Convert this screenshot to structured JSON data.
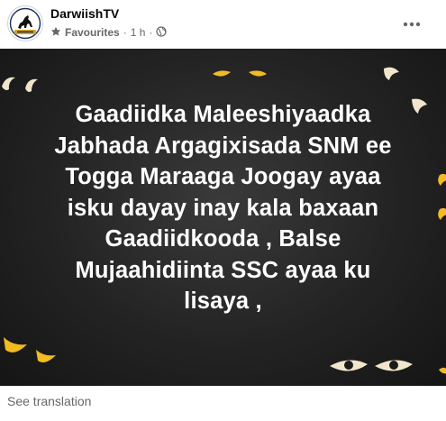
{
  "post": {
    "page_name": "DarwiishTV",
    "audience": "Favourites",
    "separator": "·",
    "time": "1 h",
    "separator2": "·",
    "logo_text": "DARWIISH TV",
    "text_lines": [
      "Gaadiidka Maleeshiyaadka",
      "Jabhada Argagixisada SNM ee",
      "Togga Maraaga Joogay ayaa",
      "isku dayay inay kala baxaan",
      "Gaadiidkooda , Balse",
      "Mujaahidiinta SSC ayaa ku",
      "lisaya ,"
    ],
    "see_translation": "See translation"
  },
  "colors": {
    "eye_yellow": "#f2bb22",
    "eye_cream": "#f1e6cc",
    "background": "#232323"
  },
  "icons": {
    "audience": "star-icon",
    "privacy": "globe-icon",
    "menu": "more-horizontal-icon"
  }
}
